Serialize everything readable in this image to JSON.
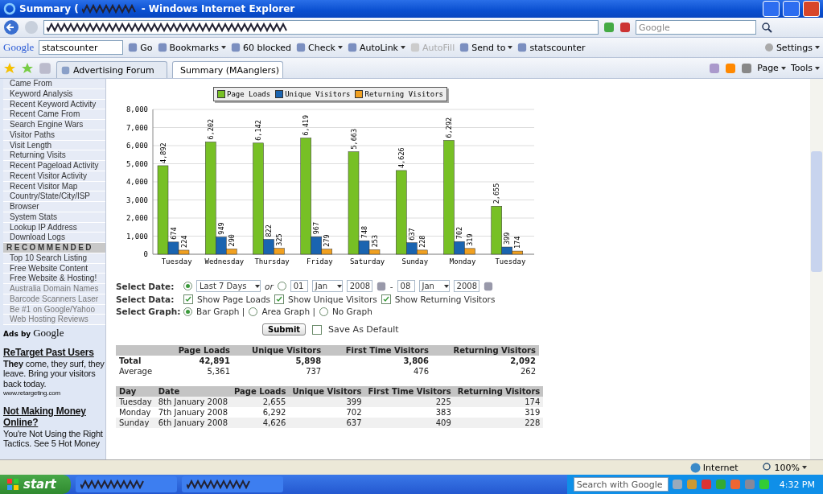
{
  "window": {
    "title": "Summary (",
    "title_suffix": "- Windows Internet Explorer"
  },
  "address_bar": {
    "search_placeholder": "Google"
  },
  "google_toolbar": {
    "logo": "Google",
    "search_value": "statscounter",
    "items": [
      {
        "label": "Go",
        "kind": "plain",
        "disabled": false
      },
      {
        "label": "Bookmarks",
        "kind": "menu",
        "disabled": false
      },
      {
        "label": "60 blocked",
        "kind": "plain",
        "disabled": false
      },
      {
        "label": "Check",
        "kind": "menu",
        "disabled": false
      },
      {
        "label": "AutoLink",
        "kind": "menu",
        "disabled": false
      },
      {
        "label": "AutoFill",
        "kind": "plain",
        "disabled": true
      },
      {
        "label": "Send to",
        "kind": "menu",
        "disabled": false
      },
      {
        "label": "statscounter",
        "kind": "plain",
        "disabled": false
      }
    ],
    "settings": "Settings"
  },
  "tabs": [
    {
      "label": "Advertising Forum",
      "selected": false
    },
    {
      "label": "Summary (MAanglers)",
      "selected": true
    }
  ],
  "command_bar": [
    "Page",
    "Tools"
  ],
  "sidebar": {
    "items": [
      {
        "label": "Came From",
        "kind": "link"
      },
      {
        "label": "Keyword Analysis",
        "kind": "link"
      },
      {
        "label": "Recent Keyword Activity",
        "kind": "link"
      },
      {
        "label": "Recent Came From",
        "kind": "link"
      },
      {
        "label": "Search Engine Wars",
        "kind": "link"
      },
      {
        "label": "Visitor Paths",
        "kind": "link"
      },
      {
        "label": "Visit Length",
        "kind": "link"
      },
      {
        "label": "Returning Visits",
        "kind": "link"
      },
      {
        "label": "Recent Pageload Activity",
        "kind": "link"
      },
      {
        "label": "Recent Visitor Activity",
        "kind": "link"
      },
      {
        "label": "Recent Visitor Map",
        "kind": "link"
      },
      {
        "label": "Country/State/City/ISP",
        "kind": "link"
      },
      {
        "label": "Browser",
        "kind": "link"
      },
      {
        "label": "System Stats",
        "kind": "link"
      },
      {
        "label": "Lookup IP Address",
        "kind": "link"
      },
      {
        "label": "Download Logs",
        "kind": "link"
      },
      {
        "label": "RECOMMENDED",
        "kind": "header"
      },
      {
        "label": "Top 10 Search Listing",
        "kind": "link"
      },
      {
        "label": "Free Website Content",
        "kind": "link"
      },
      {
        "label": "Free Website & Hosting!",
        "kind": "link"
      },
      {
        "label": "Australia Domain Names",
        "kind": "ad"
      },
      {
        "label": "Barcode Scanners Laser",
        "kind": "ad"
      },
      {
        "label": "Be #1 on Google/Yahoo",
        "kind": "ad"
      },
      {
        "label": "Web Hosting Reviews",
        "kind": "ad"
      }
    ],
    "ads_label": "Ads by",
    "ads_brand": "Google",
    "ads": [
      {
        "title": "**Re**Target Past Users",
        "text": "**They** come, they surf, they leave. Bring your visitors back today.",
        "url": "www.retargeting.com"
      },
      {
        "title": "Not Making Money Online?",
        "text": "You're Not Using the Right Tactics. See 5 Hot Money"
      }
    ]
  },
  "chart": {
    "chart_data": {
      "type": "bar",
      "categories": [
        "Tuesday",
        "Wednesday",
        "Thursday",
        "Friday",
        "Saturday",
        "Sunday",
        "Monday",
        "Tuesday"
      ],
      "ylim": [
        0,
        8000
      ],
      "yticks": [
        {
          "value": 0,
          "label": "0"
        },
        {
          "value": 1000,
          "label": "1,000"
        },
        {
          "value": 2000,
          "label": "2,000"
        },
        {
          "value": 3000,
          "label": "3,000"
        },
        {
          "value": 4000,
          "label": "4,000"
        },
        {
          "value": 5000,
          "label": "5,000"
        },
        {
          "value": 6000,
          "label": "6,000"
        },
        {
          "value": 7000,
          "label": "7,000"
        },
        {
          "value": 8000,
          "label": "8,000"
        }
      ],
      "grid": true,
      "series": [
        {
          "name": "Page Loads",
          "color": "#77c025",
          "values": [
            4892,
            6202,
            6142,
            6419,
            5663,
            4626,
            6292,
            2655
          ],
          "value_labels": [
            "4,892",
            "6,202",
            "6,142",
            "6,419",
            "5,663",
            "4,626",
            "6,292",
            "2,655"
          ]
        },
        {
          "name": "Unique Visitors",
          "color": "#1a64b0",
          "values": [
            674,
            949,
            822,
            967,
            748,
            637,
            702,
            399
          ],
          "value_labels": [
            "674",
            "949",
            "822",
            "967",
            "748",
            "637",
            "702",
            "399"
          ]
        },
        {
          "name": "Returning Visitors",
          "color": "#f0a020",
          "values": [
            224,
            290,
            325,
            279,
            253,
            228,
            319,
            174
          ],
          "value_labels": [
            "224",
            "290",
            "325",
            "279",
            "253",
            "228",
            "319",
            "174"
          ]
        }
      ]
    }
  },
  "form": {
    "date_label": "Select Date:",
    "range_selected": true,
    "range_value": "Last 7 Days",
    "or": "or",
    "custom_selected": false,
    "from": {
      "day": "01",
      "month": "Jan",
      "year": "2008"
    },
    "dash": "-",
    "to": {
      "day": "08",
      "month": "Jan",
      "year": "2008"
    },
    "data_label": "Select Data:",
    "data_options": [
      {
        "label": "Show Page Loads",
        "checked": true
      },
      {
        "label": "Show Unique Visitors",
        "checked": true
      },
      {
        "label": "Show Returning Visitors",
        "checked": true
      }
    ],
    "graph_label": "Select Graph:",
    "graph_options": [
      {
        "label": "Bar Graph |",
        "selected": true
      },
      {
        "label": "Area Graph |",
        "selected": false
      },
      {
        "label": "No Graph",
        "selected": false
      }
    ],
    "submit": "Submit",
    "save_default": {
      "label": "Save As Default",
      "checked": false
    }
  },
  "summary_table": {
    "columns": [
      "Page Loads",
      "Unique Visitors",
      "First Time Visitors",
      "Returning Visitors"
    ],
    "rows": [
      {
        "label": "Total",
        "bold": true,
        "values": [
          "42,891",
          "5,898",
          "3,806",
          "2,092"
        ]
      },
      {
        "label": "Average",
        "bold": false,
        "values": [
          "5,361",
          "737",
          "476",
          "262"
        ]
      }
    ]
  },
  "daily_table": {
    "columns": [
      "Day",
      "Date",
      "Page Loads",
      "Unique Visitors",
      "First Time Visitors",
      "Returning Visitors"
    ],
    "rows": [
      [
        "Tuesday",
        "8th January 2008",
        "2,655",
        "399",
        "225",
        "174"
      ],
      [
        "Monday",
        "7th January 2008",
        "6,292",
        "702",
        "383",
        "319"
      ],
      [
        "Sunday",
        "6th January 2008",
        "4,626",
        "637",
        "409",
        "228"
      ]
    ]
  },
  "status_bar": {
    "zone": "Internet",
    "zoom": "100%"
  },
  "taskbar": {
    "start": "start",
    "search_placeholder": "Search with Google",
    "time": "4:32 PM"
  }
}
